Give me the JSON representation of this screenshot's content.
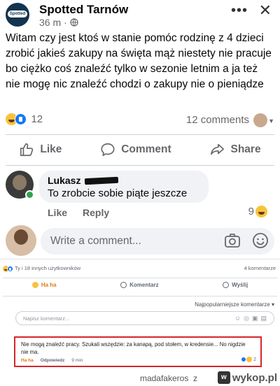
{
  "post": {
    "page_name": "Spotted Tarnów",
    "time": "36 m",
    "dot": "·",
    "text": "Witam czy jest ktoś w stanie pomóc rodzinę z 4 dzieci zrobić jakieś zakupy na święta mąż niestety nie pracuje bo ciężko coś znaleźć tylko w sezonie letnim a ja też nie mogę nic znaleźć chodzi o zakupy nie o pieniądze",
    "reaction_count": "12",
    "comments_count": "12 comments",
    "actions": {
      "like": "Like",
      "comment": "Comment",
      "share": "Share"
    }
  },
  "comment": {
    "author": "Lukasz",
    "text": "To zrobcie sobie piąte jeszcze",
    "like": "Like",
    "reply": "Reply",
    "reaction_count": "9"
  },
  "composer": {
    "placeholder": "Write a comment..."
  },
  "old_post": {
    "reactions_text": "Ty i 18 innych użytkowników",
    "comments_count": "4 komentarze",
    "haha": "Ha ha",
    "comment": "Komentarz",
    "share": "Wyślij",
    "sort": "Najpopularniejsze komentarze",
    "write_placeholder": "Napisz komentarz...",
    "highlight_comment": "Nie mogą znaleźć pracy. Szukali wszędzie: za kanapą, pod stołem, w kredensie... No nigdzie nie ma.",
    "c_haha": "Ha ha",
    "c_reply": "Odpowiedz",
    "c_time": "9 min",
    "c_count": "2"
  },
  "watermark": {
    "user": "madafakeros",
    "z": "z",
    "site": "wykop.pl"
  },
  "colors": {
    "fb_blue": "#1877f2",
    "haha": "#f7c33f",
    "highlight_border": "#d6262a",
    "online": "#31a24c"
  }
}
